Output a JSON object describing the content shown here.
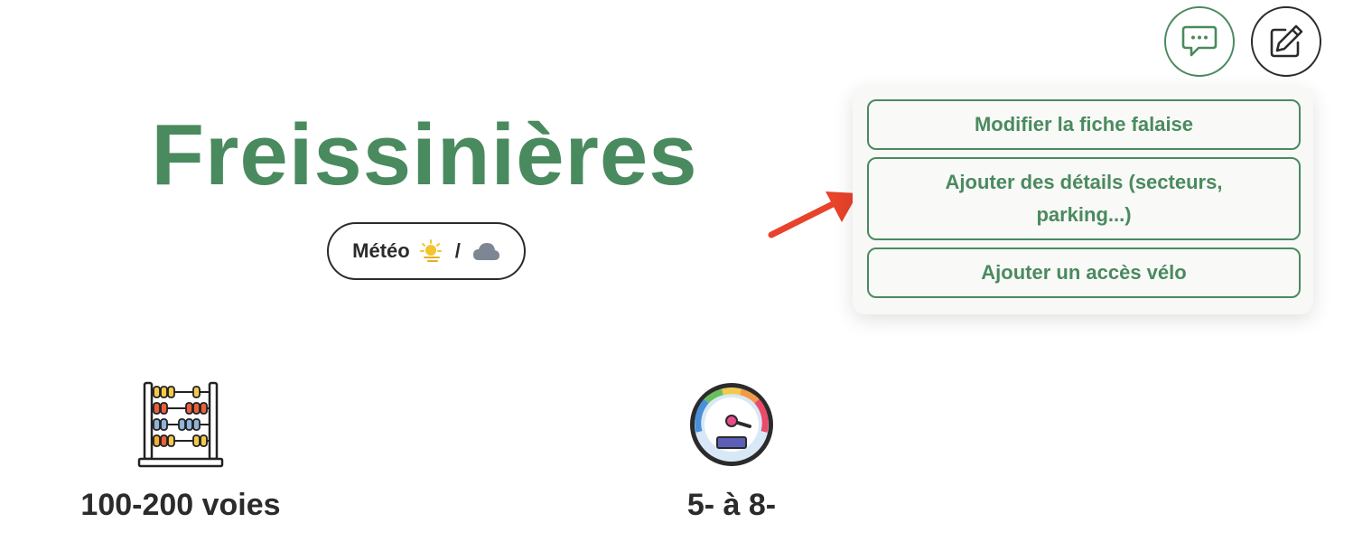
{
  "header": {
    "chat_button_icon": "chat-bubble-icon",
    "edit_button_icon": "edit-pencil-icon"
  },
  "crag": {
    "name": "Freissinières"
  },
  "weather": {
    "label": "Météo",
    "separator": "/",
    "icons": [
      "sun-icon",
      "cloud-icon"
    ]
  },
  "menu": {
    "items": [
      {
        "label": "Modifier la fiche falaise"
      },
      {
        "label": "Ajouter des détails (secteurs, parking...)"
      },
      {
        "label": "Ajouter un accès vélo"
      }
    ]
  },
  "stats": {
    "routes": {
      "label": "100-200 voies",
      "icon": "abacus-icon"
    },
    "grades": {
      "label": "5- à 8-",
      "icon": "gauge-icon"
    }
  },
  "colors": {
    "brand_green": "#4a8a5f",
    "text_dark": "#2b2b2b",
    "arrow_red": "#e8432b"
  }
}
